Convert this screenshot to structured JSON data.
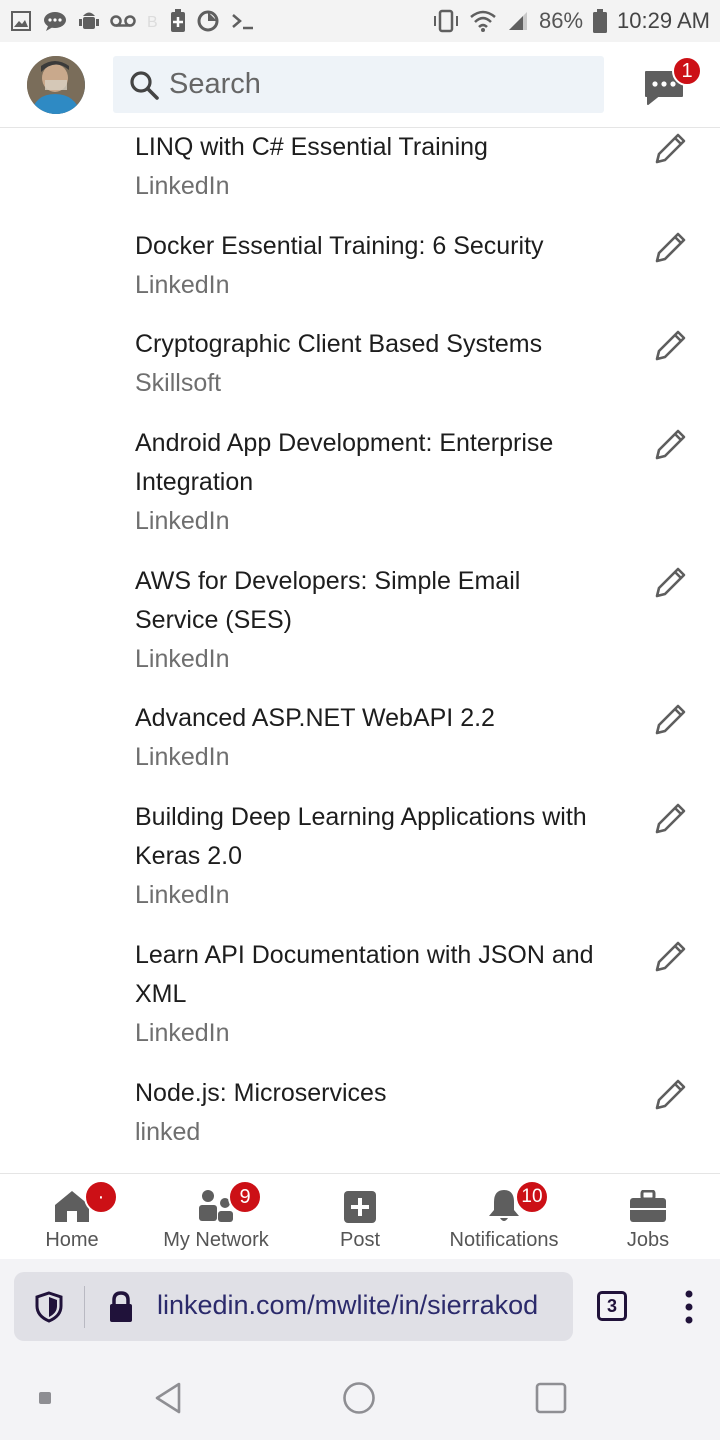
{
  "status_bar": {
    "battery": "86%",
    "time": "10:29 AM"
  },
  "header": {
    "search_placeholder": "Search",
    "messages_badge": "1"
  },
  "courses": [
    {
      "title": "LINQ with C# Essential Training",
      "org": "LinkedIn"
    },
    {
      "title": "Docker Essential Training: 6 Security",
      "org": "LinkedIn"
    },
    {
      "title": "Cryptographic Client Based Systems",
      "org": "Skillsoft"
    },
    {
      "title": "Android App Development: Enterprise Integration",
      "org": "LinkedIn"
    },
    {
      "title": "AWS for Developers: Simple Email Service (SES)",
      "org": "LinkedIn"
    },
    {
      "title": "Advanced ASP.NET WebAPI 2.2",
      "org": "LinkedIn"
    },
    {
      "title": "Building Deep Learning Applications with Keras 2.0",
      "org": "LinkedIn"
    },
    {
      "title": "Learn API Documentation with JSON and XML",
      "org": "LinkedIn"
    },
    {
      "title": "Node.js: Microservices",
      "org": "linked"
    }
  ],
  "bottom_nav": {
    "home": {
      "label": "Home",
      "badge": "·"
    },
    "network": {
      "label": "My Network",
      "badge": "9"
    },
    "post": {
      "label": "Post"
    },
    "notifications": {
      "label": "Notifications",
      "badge": "10"
    },
    "jobs": {
      "label": "Jobs"
    }
  },
  "browser": {
    "url": "linkedin.com/mwlite/in/sierrakod",
    "tab_count": "3"
  },
  "colors": {
    "badge_red": "#cc1016",
    "icon_gray": "#5e5e5e",
    "search_bg": "#eef3f8"
  }
}
